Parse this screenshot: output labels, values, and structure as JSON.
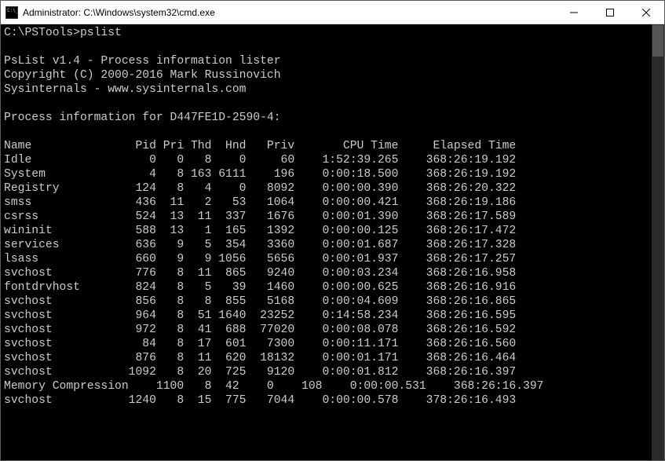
{
  "titlebar": {
    "text": "Administrator: C:\\Windows\\system32\\cmd.exe"
  },
  "terminal": {
    "prompt": "C:\\PSTools>",
    "command": "pslist",
    "header1": "PsList v1.4 - Process information lister",
    "header2": "Copyright (C) 2000-2016 Mark Russinovich",
    "header3": "Sysinternals - www.sysinternals.com",
    "info_line": "Process information for D447FE1D-2590-4:",
    "columns": {
      "name": "Name",
      "pid": "Pid",
      "pri": "Pri",
      "thd": "Thd",
      "hnd": "Hnd",
      "priv": "Priv",
      "cpu": "CPU Time",
      "elapsed": "Elapsed Time"
    },
    "processes": [
      {
        "name": "Idle",
        "pid": "0",
        "pri": "0",
        "thd": "8",
        "hnd": "0",
        "priv": "60",
        "cpu": "1:52:39.265",
        "elapsed": "368:26:19.192"
      },
      {
        "name": "System",
        "pid": "4",
        "pri": "8",
        "thd": "163",
        "hnd": "6111",
        "priv": "196",
        "cpu": "0:00:18.500",
        "elapsed": "368:26:19.192"
      },
      {
        "name": "Registry",
        "pid": "124",
        "pri": "8",
        "thd": "4",
        "hnd": "0",
        "priv": "8092",
        "cpu": "0:00:00.390",
        "elapsed": "368:26:20.322"
      },
      {
        "name": "smss",
        "pid": "436",
        "pri": "11",
        "thd": "2",
        "hnd": "53",
        "priv": "1064",
        "cpu": "0:00:00.421",
        "elapsed": "368:26:19.186"
      },
      {
        "name": "csrss",
        "pid": "524",
        "pri": "13",
        "thd": "11",
        "hnd": "337",
        "priv": "1676",
        "cpu": "0:00:01.390",
        "elapsed": "368:26:17.589"
      },
      {
        "name": "wininit",
        "pid": "588",
        "pri": "13",
        "thd": "1",
        "hnd": "165",
        "priv": "1392",
        "cpu": "0:00:00.125",
        "elapsed": "368:26:17.472"
      },
      {
        "name": "services",
        "pid": "636",
        "pri": "9",
        "thd": "5",
        "hnd": "354",
        "priv": "3360",
        "cpu": "0:00:01.687",
        "elapsed": "368:26:17.328"
      },
      {
        "name": "lsass",
        "pid": "660",
        "pri": "9",
        "thd": "9",
        "hnd": "1056",
        "priv": "5656",
        "cpu": "0:00:01.937",
        "elapsed": "368:26:17.257"
      },
      {
        "name": "svchost",
        "pid": "776",
        "pri": "8",
        "thd": "11",
        "hnd": "865",
        "priv": "9240",
        "cpu": "0:00:03.234",
        "elapsed": "368:26:16.958"
      },
      {
        "name": "fontdrvhost",
        "pid": "824",
        "pri": "8",
        "thd": "5",
        "hnd": "39",
        "priv": "1460",
        "cpu": "0:00:00.625",
        "elapsed": "368:26:16.916"
      },
      {
        "name": "svchost",
        "pid": "856",
        "pri": "8",
        "thd": "8",
        "hnd": "855",
        "priv": "5168",
        "cpu": "0:00:04.609",
        "elapsed": "368:26:16.865"
      },
      {
        "name": "svchost",
        "pid": "964",
        "pri": "8",
        "thd": "51",
        "hnd": "1640",
        "priv": "23252",
        "cpu": "0:14:58.234",
        "elapsed": "368:26:16.595"
      },
      {
        "name": "svchost",
        "pid": "972",
        "pri": "8",
        "thd": "41",
        "hnd": "688",
        "priv": "77020",
        "cpu": "0:00:08.078",
        "elapsed": "368:26:16.592"
      },
      {
        "name": "svchost",
        "pid": "84",
        "pri": "8",
        "thd": "17",
        "hnd": "601",
        "priv": "7300",
        "cpu": "0:00:11.171",
        "elapsed": "368:26:16.560"
      },
      {
        "name": "svchost",
        "pid": "876",
        "pri": "8",
        "thd": "11",
        "hnd": "620",
        "priv": "18132",
        "cpu": "0:00:01.171",
        "elapsed": "368:26:16.464"
      },
      {
        "name": "svchost",
        "pid": "1092",
        "pri": "8",
        "thd": "20",
        "hnd": "725",
        "priv": "9120",
        "cpu": "0:00:01.812",
        "elapsed": "368:26:16.397"
      },
      {
        "name": "Memory Compression",
        "pid": "1100",
        "pri": "8",
        "thd": "42",
        "hnd": "0",
        "priv": "108",
        "cpu": "0:00:00.531",
        "elapsed": "368:26:16.397"
      },
      {
        "name": "svchost",
        "pid": "1240",
        "pri": "8",
        "thd": "15",
        "hnd": "775",
        "priv": "7044",
        "cpu": "0:00:00.578",
        "elapsed": "378:26:16.493"
      }
    ]
  }
}
